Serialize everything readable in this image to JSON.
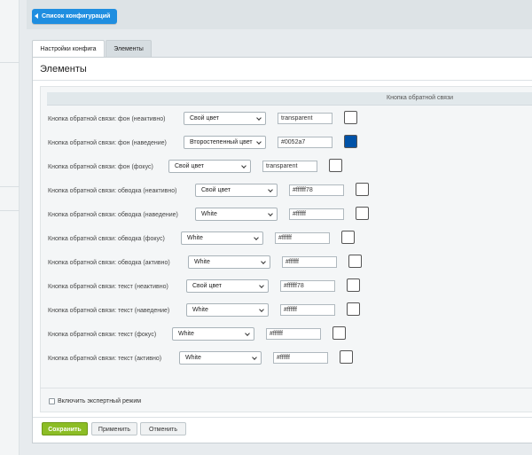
{
  "header": {
    "back_label": "Список конфигураций"
  },
  "tabs": [
    {
      "label": "Настройки конфига"
    },
    {
      "label": "Элементы"
    }
  ],
  "panel": {
    "title": "Элементы",
    "column_header": "Кнопка обратной связи"
  },
  "rows": [
    {
      "label": "Кнопка обратной связи: фон (неактивно)",
      "select": "Свой цвет",
      "value": "transparent",
      "swatch": "#ffffff"
    },
    {
      "label": "Кнопка обратной связи: фон (наведение)",
      "select": "Второстепенный цвет",
      "value": "#0052a7",
      "swatch": "#0052a7"
    },
    {
      "label": "Кнопка обратной связи: фон (фокус)",
      "select": "Свой цвет",
      "value": "transparent",
      "swatch": "#ffffff"
    },
    {
      "label": "Кнопка обратной связи: обводка (неактивно)",
      "select": "Свой цвет",
      "value": "#ffffff78",
      "swatch": "#ffffff"
    },
    {
      "label": "Кнопка обратной связи: обводка (наведение)",
      "select": "White",
      "value": "#ffffff",
      "swatch": "#ffffff"
    },
    {
      "label": "Кнопка обратной связи: обводка (фокус)",
      "select": "White",
      "value": "#ffffff",
      "swatch": "#ffffff"
    },
    {
      "label": "Кнопка обратной связи: обводка (активно)",
      "select": "White",
      "value": "#ffffff",
      "swatch": "#ffffff"
    },
    {
      "label": "Кнопка обратной связи: текст (неактивно)",
      "select": "Свой цвет",
      "value": "#ffffff78",
      "swatch": "#ffffff"
    },
    {
      "label": "Кнопка обратной связи: текст (наведение)",
      "select": "White",
      "value": "#ffffff",
      "swatch": "#ffffff"
    },
    {
      "label": "Кнопка обратной связи: текст (фокус)",
      "select": "White",
      "value": "#ffffff",
      "swatch": "#ffffff"
    },
    {
      "label": "Кнопка обратной связи: текст (активно)",
      "select": "White",
      "value": "#ffffff",
      "swatch": "#ffffff"
    }
  ],
  "expert_mode_label": "Включить экспертный режим",
  "buttons": {
    "save": "Сохранить",
    "apply": "Применить",
    "cancel": "Отменить"
  },
  "colors": {
    "accent": "#1f8ee0",
    "save": "#8cbd25",
    "secondary": "#0052a7"
  }
}
